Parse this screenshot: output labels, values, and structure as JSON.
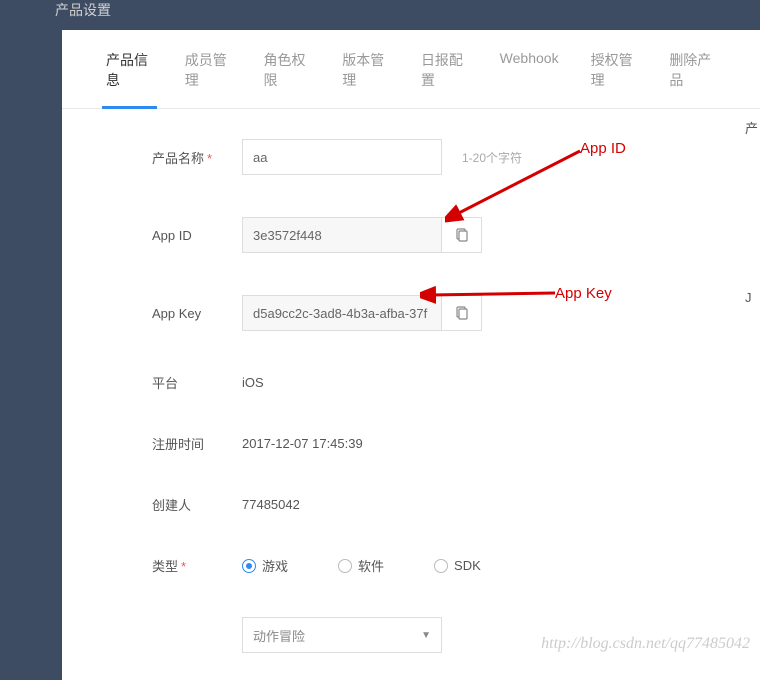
{
  "header": {
    "title": "产品设置"
  },
  "tabs": [
    {
      "label": "产品信息",
      "active": true
    },
    {
      "label": "成员管理",
      "active": false
    },
    {
      "label": "角色权限",
      "active": false
    },
    {
      "label": "版本管理",
      "active": false
    },
    {
      "label": "日报配置",
      "active": false
    },
    {
      "label": "Webhook",
      "active": false
    },
    {
      "label": "授权管理",
      "active": false
    },
    {
      "label": "删除产品",
      "active": false
    }
  ],
  "form": {
    "product_name": {
      "label": "产品名称",
      "value": "aa",
      "hint": "1-20个字符",
      "required": true
    },
    "app_id": {
      "label": "App ID",
      "value": "3e3572f448"
    },
    "app_key": {
      "label": "App Key",
      "value": "d5a9cc2c-3ad8-4b3a-afba-37f"
    },
    "platform": {
      "label": "平台",
      "value": "iOS"
    },
    "register_time": {
      "label": "注册时间",
      "value": "2017-12-07 17:45:39"
    },
    "creator": {
      "label": "创建人",
      "value": "77485042"
    },
    "type": {
      "label": "类型",
      "required": true,
      "options": [
        {
          "label": "游戏",
          "checked": true
        },
        {
          "label": "软件",
          "checked": false
        },
        {
          "label": "SDK",
          "checked": false
        }
      ]
    },
    "category_select": {
      "value": "动作冒险"
    }
  },
  "annotations": {
    "app_id_label": "App ID",
    "app_key_label": "App Key"
  },
  "watermark": "http://blog.csdn.net/qq77485042",
  "side_chars": {
    "a": "产",
    "b": "J"
  }
}
